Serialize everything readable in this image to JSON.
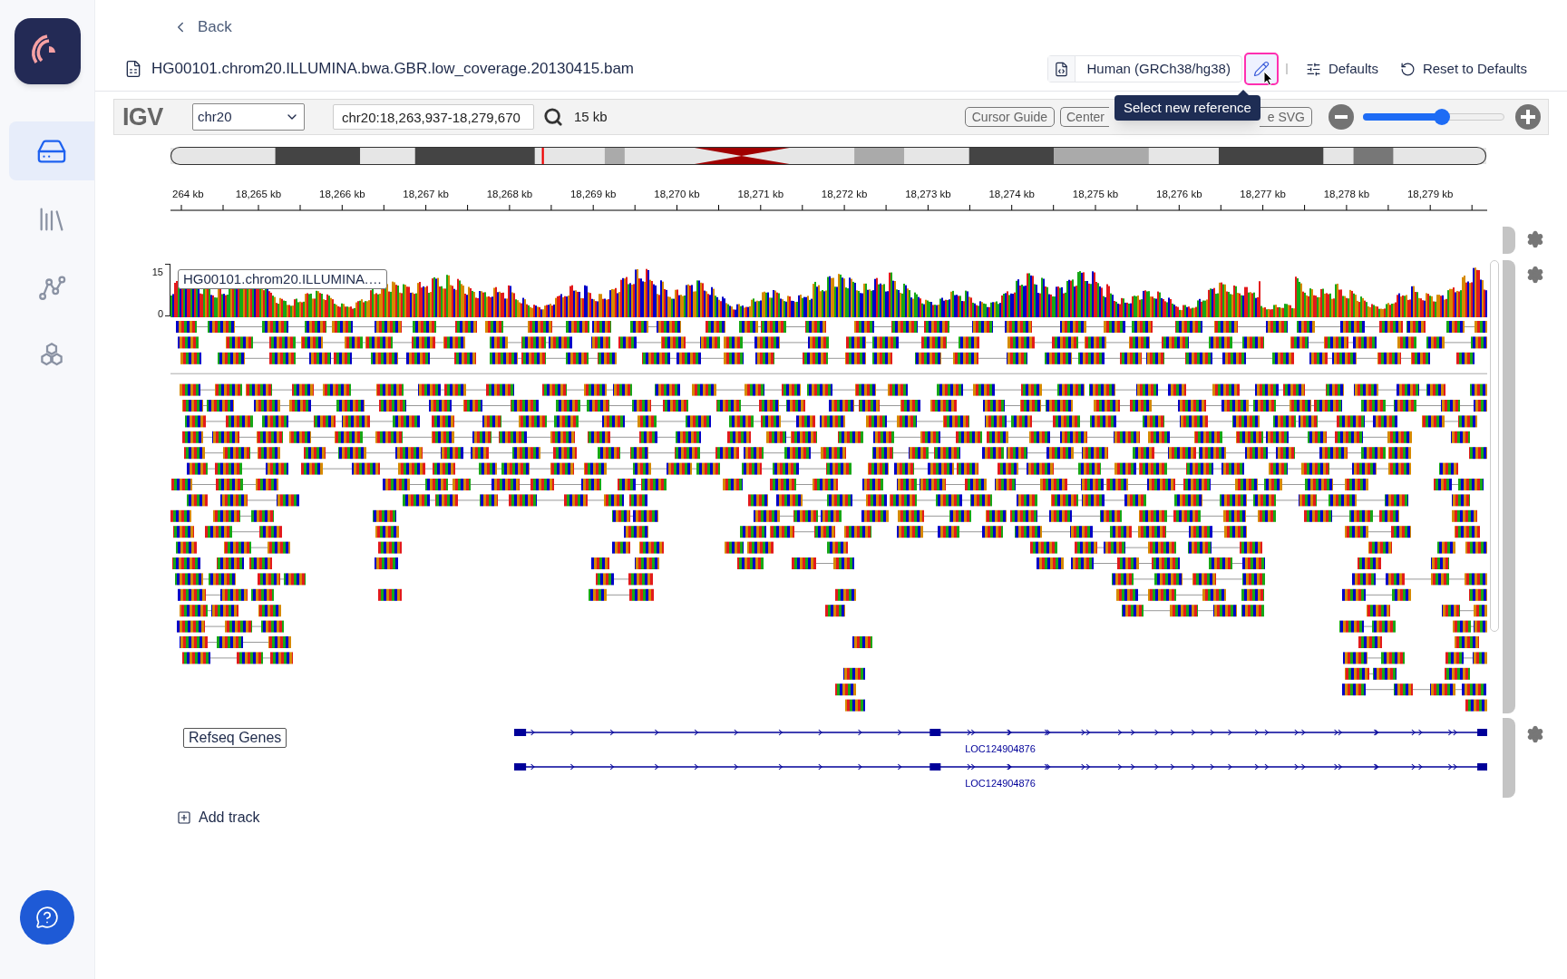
{
  "sidebar": {
    "nav_items": [
      {
        "kind": "storage",
        "selected": true
      },
      {
        "kind": "library",
        "selected": false
      },
      {
        "kind": "graph",
        "selected": false
      },
      {
        "kind": "modules",
        "selected": false
      }
    ]
  },
  "back_link": "Back",
  "file": {
    "title": "HG00101.chrom20.ILLUMINA.bwa.GBR.low_coverage.20130415.bam"
  },
  "reference": {
    "label": "Human (GRCh38/hg38)",
    "edit_hovered": true,
    "tooltip": "Select new reference"
  },
  "header_actions": [
    {
      "kind": "defaults",
      "label": "Defaults"
    },
    {
      "kind": "reset",
      "label": "Reset to Defaults"
    }
  ],
  "igv": {
    "logo": "IGV",
    "chromosome": "chr20",
    "locus": "chr20:18,263,937-18,279,670",
    "width_label": "15 kb",
    "buttons": [
      "Cursor Guide",
      "Center",
      "e SVG"
    ],
    "zoom": {
      "level": 0.56
    }
  },
  "ruler": {
    "labels": [
      "264 kb",
      "18,265 kb",
      "18,266 kb",
      "18,267 kb",
      "18,268 kb",
      "18,269 kb",
      "18,270 kb",
      "18,271 kb",
      "18,272 kb",
      "18,273 kb",
      "18,274 kb",
      "18,275 kb",
      "18,276 kb",
      "18,277 kb",
      "18,278 kb",
      "18,279 kb"
    ]
  },
  "tracks": [
    {
      "kind": "coverage",
      "name": "HG00101.chrom20.ILLUMINA.…",
      "range_max": "15",
      "range_min": "0"
    },
    {
      "kind": "alignments"
    },
    {
      "kind": "annotation",
      "name": "Refseq Genes",
      "features": [
        "LOC124904876",
        "LOC124904876"
      ]
    }
  ],
  "add_track": "Add track"
}
